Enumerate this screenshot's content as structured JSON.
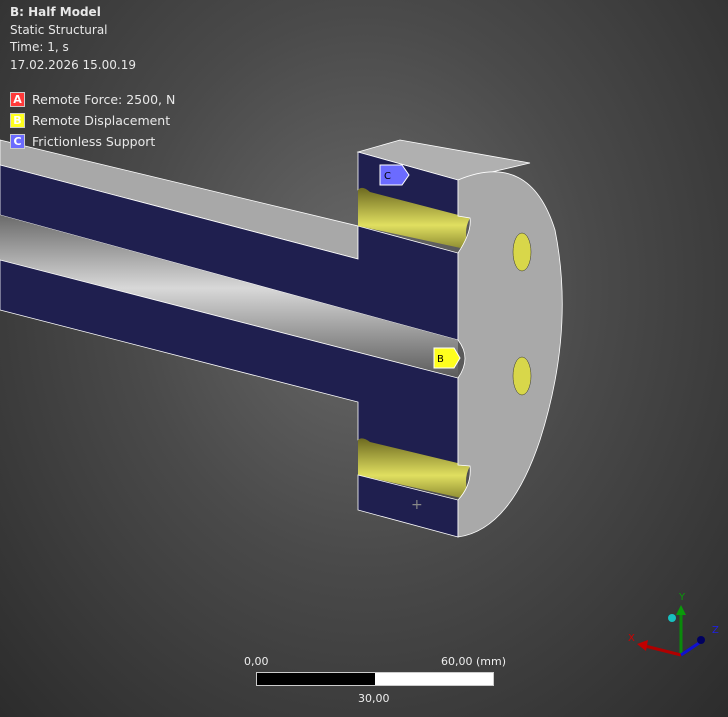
{
  "header": {
    "title": "B: Half Model",
    "analysis": "Static Structural",
    "time": "Time: 1, s",
    "timestamp": "17.02.2026 15.00.19"
  },
  "legend": [
    {
      "letter": "A",
      "label": "Remote Force: 2500, N",
      "color": "#ff3a3a"
    },
    {
      "letter": "B",
      "label": "Remote Displacement",
      "color": "#ffff1e"
    },
    {
      "letter": "C",
      "label": "Frictionless Support",
      "color": "#6b6bff"
    }
  ],
  "tags": {
    "b": "B",
    "c": "C"
  },
  "scale": {
    "left": "0,00",
    "right": "60,00 (mm)",
    "mid": "30,00"
  },
  "triad": {
    "x": "X",
    "y": "Y",
    "z": "Z"
  }
}
